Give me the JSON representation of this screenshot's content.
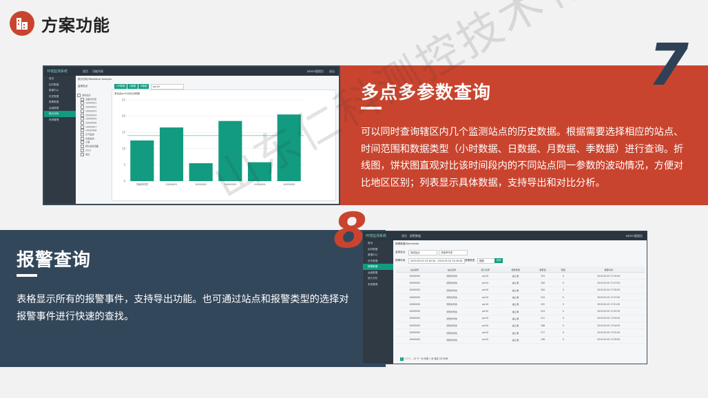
{
  "header": {
    "title": "方案功能"
  },
  "section1": {
    "number": "7",
    "title": "多点多参数查询",
    "description": "可以同时查询辖区内几个监测站点的历史数据。根据需要选择相应的站点、时间范围和数据类型（小时数据、日数据、月数据、季数据）进行查询。折线图，饼状图直观对比该时间段内的不同站点同一参数的波动情况，方便对比地区区别；列表显示具体数据，支持导出和对比分析。"
  },
  "section2": {
    "number": "8",
    "title": "报警查询",
    "description": "表格显示所有的报警事件，支持导出功能。也可通过站点和报警类型的选择对报警事件进行快速的查找。"
  },
  "watermark": "山东仁科测控技术有限公司",
  "shot1": {
    "brand": "环境监测系统",
    "tabs": [
      "首页",
      "功能列表"
    ],
    "user": "admin管理员",
    "logout": "退出",
    "breadcrumb": "统计分析/Statistical Analysis",
    "station_label": "监测站点",
    "buttons": [
      "小时数据",
      "日数据",
      "月数据"
    ],
    "param": "pm10",
    "chart_title": "多站点pm10对比分析图",
    "sidebar": [
      "首页",
      "实时数据",
      "数据中心",
      "历史数据",
      "报警数据",
      "运维数据",
      "统计分析",
      "系统管理"
    ],
    "tree": [
      "测试站点",
      "济南市环境",
      "10000001",
      "10000002",
      "10000003",
      "10000004",
      "10000005",
      "10000006",
      "10000007",
      "10000008",
      "大气监测",
      "水质监测",
      "土壤",
      "扬尘监测设备",
      "2222",
      "测试"
    ]
  },
  "chart_data": {
    "type": "bar",
    "categories": [
      "济南市环境",
      "10000001",
      "10000002",
      "10000003",
      "10000004",
      "10000005"
    ],
    "values": [
      12.5,
      16.5,
      5.5,
      18.5,
      5.8,
      20.5
    ],
    "ylim": [
      0,
      25
    ],
    "yticks": [
      0,
      5,
      10,
      15,
      20,
      25
    ],
    "threshold": 14,
    "color": "#129b80"
  },
  "shot2": {
    "brand": "环境监测系统",
    "tabs": [
      "首页",
      "报警数据"
    ],
    "user": "admin管理员",
    "breadcrumb": "报警数据/Alarmdata",
    "station_label": "监测站点",
    "station_value": "测试站点",
    "station_value2": "济南市环境",
    "time_label": "报警时间",
    "time_value": "2019-03-20 15:16:34 - 2019-03-20 15:16:34",
    "type_label": "报警类型",
    "type_value": "超限",
    "search_btn": "查询",
    "sidebar": [
      "首页",
      "实时数据",
      "数据中心",
      "历史数据",
      "报警数据",
      "运维数据",
      "统计分析",
      "系统管理"
    ],
    "columns": [
      "站点编号",
      "站点名称",
      "因子名称",
      "报警类型",
      "报警值",
      "限值",
      "报警时间"
    ],
    "rows": [
      [
        "10000000",
        "济南市环境",
        "pm10",
        "超上限",
        "153",
        "0",
        "2019-03-20 17:35:50"
      ],
      [
        "10000000",
        "济南市环境",
        "pm10",
        "超上限",
        "164",
        "0",
        "2019-03-20 17:37:50"
      ],
      [
        "10000000",
        "济南市环境",
        "pm10",
        "超上限",
        "164",
        "0",
        "2019-03-20 17:35:50"
      ],
      [
        "10000000",
        "济南市环境",
        "pm10",
        "超上限",
        "154",
        "0",
        "2019-03-20 17:37:50"
      ],
      [
        "10000000",
        "济南市环境",
        "pm10",
        "超上限",
        "192",
        "0",
        "2019-03-20 17:31:50"
      ],
      [
        "10000000",
        "济南市环境",
        "pm10",
        "超上限",
        "224",
        "0",
        "2019-03-20 17:52:50"
      ],
      [
        "10000000",
        "济南市环境",
        "pm10",
        "超上限",
        "211",
        "0",
        "2019-03-20 17:54:50"
      ],
      [
        "10000000",
        "济南市环境",
        "pm10",
        "超上限",
        "188",
        "0",
        "2019-03-20 17:54:50"
      ],
      [
        "10000000",
        "济南市环境",
        "pm10",
        "超上限",
        "277",
        "0",
        "2019-03-20 17:52:50"
      ],
      [
        "10000000",
        "济南市环境",
        "pm10",
        "超上限",
        "198",
        "0",
        "2019-03-20 17:59:50"
      ]
    ],
    "pager": "1 2 3 ... 24 下一页 到第 1 页 确定 共236条"
  }
}
